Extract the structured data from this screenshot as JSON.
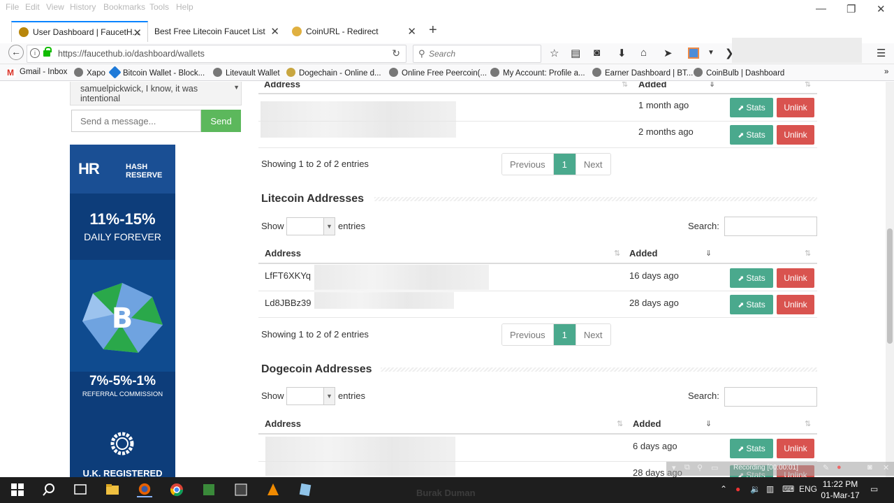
{
  "menu": [
    "File",
    "Edit",
    "View",
    "History",
    "Bookmarks",
    "Tools",
    "Help"
  ],
  "window_controls": {
    "minimize": "—",
    "restore": "❐",
    "close": "✕"
  },
  "tabs": [
    {
      "label": "User Dashboard | FaucetH...",
      "active": true
    },
    {
      "label": "Best Free Litecoin Faucet List",
      "active": false
    },
    {
      "label": "CoinURL - Redirect",
      "active": false
    }
  ],
  "new_tab": "+",
  "navbar": {
    "url": "https://faucethub.io/dashboard/wallets",
    "search_placeholder": "Search"
  },
  "bookmarks": [
    "Gmail - Inbox",
    "Xapo",
    "Bitcoin Wallet - Block...",
    "Litevault Wallet",
    "Dogechain - Online d...",
    "Online Free Peercoin(...",
    "My Account: Profile a...",
    "Earner Dashboard | BT...",
    "CoinBulb | Dashboard"
  ],
  "bookmarks_more": "»",
  "chat": {
    "message": "samuelpickwick, I know, it was intentional",
    "input_placeholder": "Send a message...",
    "send_label": "Send"
  },
  "ad": {
    "brand_hr": "HR",
    "brand_text": "HASH RESERVE",
    "rate": "11%-15%",
    "rate_sub": "DAILY FOREVER",
    "referral": "7%-5%-1%",
    "referral_sub": "REFERRAL COMMISSION",
    "uk": "U.K. REGISTERED",
    "colors": {
      "dark": "#0d3d7a",
      "light": "#1a4f94",
      "green": "#2aa84a"
    }
  },
  "common": {
    "col_address": "Address",
    "col_added": "Added",
    "stats_label": "Stats",
    "unlink_label": "Unlink",
    "prev_label": "Previous",
    "next_label": "Next",
    "page_label": "1",
    "show_label": "Show",
    "entries_label": "entries",
    "search_label": "Search:",
    "sort_icon": "⇅",
    "sort_active_icon": "⇓",
    "stats_icon": "⬈"
  },
  "bitcoin": {
    "rows": [
      {
        "added": "1 month ago"
      },
      {
        "added": "2 months ago"
      }
    ],
    "showing": "Showing 1 to 2 of 2 entries"
  },
  "litecoin": {
    "title": "Litecoin Addresses",
    "rows": [
      {
        "address": "LfFT6XKYq",
        "added": "16 days ago"
      },
      {
        "address": "Ld8JBBz39",
        "added": "28 days ago"
      }
    ],
    "showing": "Showing 1 to 2 of 2 entries"
  },
  "dogecoin": {
    "title": "Dogecoin Addresses",
    "rows": [
      {
        "address": "",
        "added": "6 days ago"
      },
      {
        "address": "",
        "added": "28 days ago"
      }
    ]
  },
  "recorder": {
    "text": "Recording [00:00:01]"
  },
  "taskbar": {
    "time": "11:22 PM",
    "date": "01-Mar-17",
    "lang": "ENG",
    "watermark": "Burak Duman"
  },
  "colors": {
    "accent": "#4aa98d",
    "danger": "#d9534f",
    "success": "#5cb85c",
    "firefox_blue": "#0a84ff"
  }
}
